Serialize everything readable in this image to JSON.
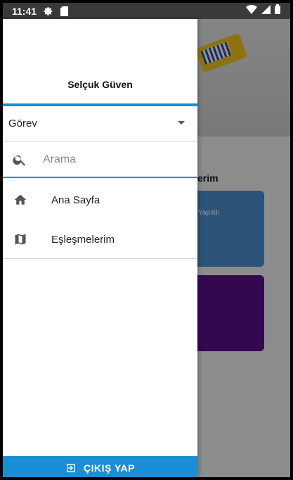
{
  "status_bar": {
    "time": "11:41",
    "icons": [
      "gear-icon",
      "sim-card-icon",
      "wifi-icon",
      "signal-icon",
      "battery-icon"
    ]
  },
  "background": {
    "section_title": "erim",
    "card1_text": "Yapıldı",
    "card1_color": "#4b8fcf",
    "card2_color": "#5b0f8a"
  },
  "drawer": {
    "user_name": "Selçuk Güven",
    "role_select": {
      "selected": "Görev"
    },
    "search": {
      "placeholder": "Arama",
      "value": ""
    },
    "menu": [
      {
        "label": "Ana Sayfa",
        "icon": "home-icon"
      },
      {
        "label": "Eşleşmelerim",
        "icon": "map-icon"
      }
    ],
    "logout_label": "ÇIKIŞ YAP",
    "accent_color": "#1a8fd6"
  }
}
